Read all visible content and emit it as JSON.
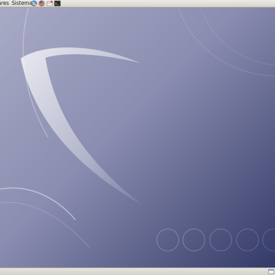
{
  "top_panel": {
    "menus": [
      {
        "label": "ares"
      },
      {
        "label": "Sistema"
      }
    ],
    "launchers": [
      {
        "icon": "network-icon"
      },
      {
        "icon": "firefox-icon"
      },
      {
        "icon": "mail-icon"
      },
      {
        "icon": "terminal-icon"
      }
    ]
  },
  "bottom_panel": {
    "icons": [
      {
        "icon": "show-desktop-icon"
      }
    ]
  },
  "colors": {
    "wallpaper_light": "#a7a9c4",
    "wallpaper_dark": "#333a66",
    "panel": "#dcdad3"
  }
}
